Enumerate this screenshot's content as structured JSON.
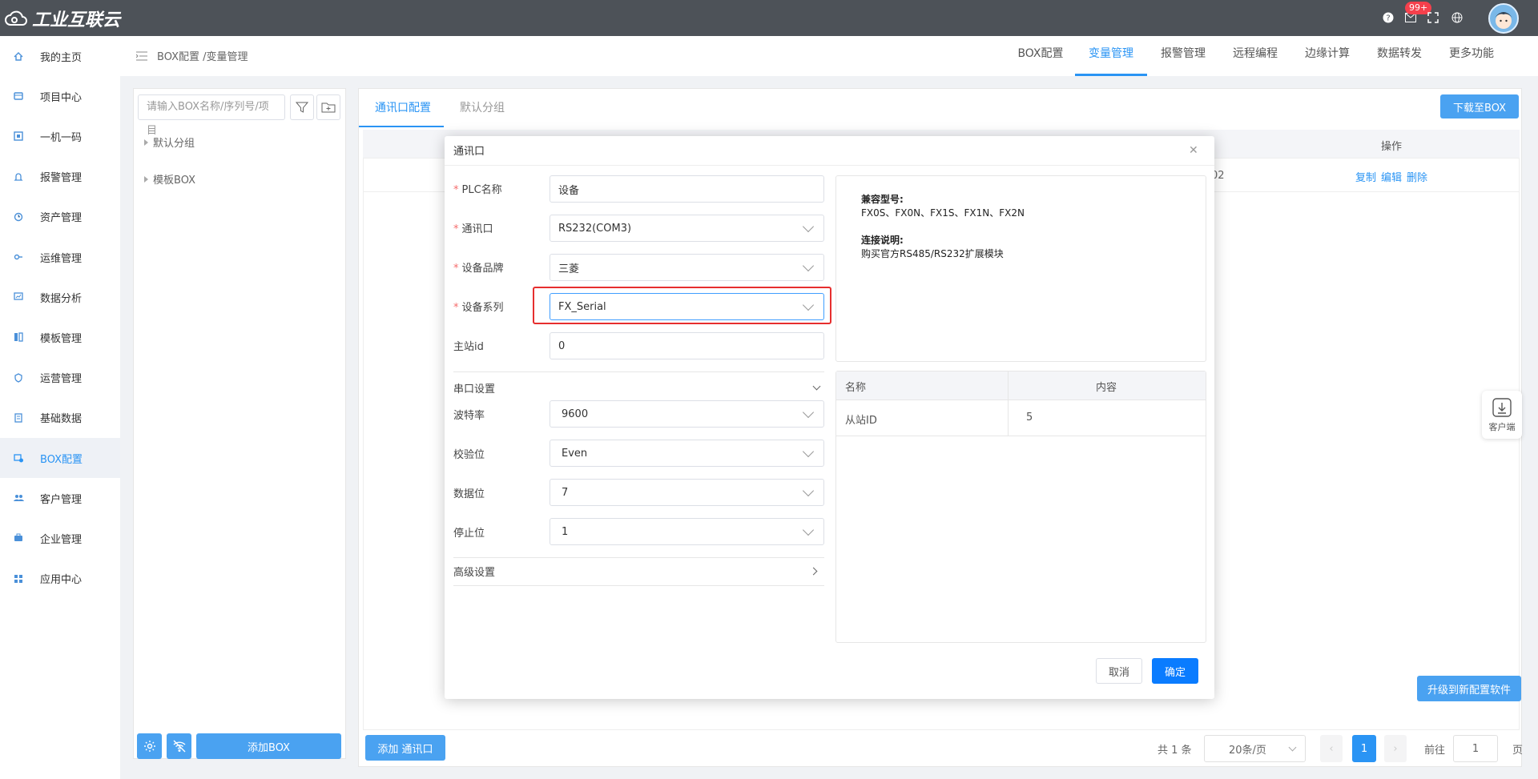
{
  "app": {
    "logo_text": "工业互联云",
    "notification_badge": "99+"
  },
  "sidebar": {
    "items": [
      {
        "label": "我的主页",
        "icon": "home-icon"
      },
      {
        "label": "项目中心",
        "icon": "project-icon"
      },
      {
        "label": "一机一码",
        "icon": "qrcode-icon"
      },
      {
        "label": "报警管理",
        "icon": "bell-icon"
      },
      {
        "label": "资产管理",
        "icon": "asset-icon"
      },
      {
        "label": "运维管理",
        "icon": "wrench-icon"
      },
      {
        "label": "数据分析",
        "icon": "chart-icon"
      },
      {
        "label": "模板管理",
        "icon": "template-icon"
      },
      {
        "label": "运营管理",
        "icon": "shield-icon"
      },
      {
        "label": "基础数据",
        "icon": "database-icon"
      },
      {
        "label": "BOX配置",
        "icon": "box-icon"
      },
      {
        "label": "客户管理",
        "icon": "users-icon"
      },
      {
        "label": "企业管理",
        "icon": "briefcase-icon"
      },
      {
        "label": "应用中心",
        "icon": "grid-icon"
      }
    ],
    "active_index": 10
  },
  "breadcrumb": {
    "text": "BOX配置 /变量管理"
  },
  "topnav": {
    "tabs": [
      "BOX配置",
      "变量管理",
      "报警管理",
      "远程编程",
      "边缘计算",
      "数据转发",
      "更多功能"
    ],
    "active_index": 1
  },
  "tree": {
    "search_placeholder": "请输入BOX名称/序列号/项目",
    "nodes": [
      "默认分组",
      "模板BOX"
    ],
    "add_box_label": "添加BOX"
  },
  "main": {
    "tabs": [
      "通讯口配置",
      "默认分组"
    ],
    "active_tab_index": 0,
    "download_button": "下载至BOX",
    "table_header_action": "操作",
    "row_partial_text": "02",
    "row_actions": [
      "复制",
      "编辑",
      "删除"
    ],
    "add_port_button": "添加 通讯口",
    "upgrade_button": "升级到新配置软件",
    "pagination": {
      "total": "共 1 条",
      "page_size": "20条/页",
      "current_page": "1",
      "goto_label": "前往",
      "goto_value": "1",
      "page_suffix": "页"
    }
  },
  "dialog": {
    "title": "通讯口",
    "fields": {
      "plc_name": {
        "label": "PLC名称",
        "value": "设备",
        "required": true
      },
      "port": {
        "label": "通讯口",
        "value": "RS232(COM3)",
        "required": true
      },
      "brand": {
        "label": "设备品牌",
        "value": "三菱",
        "required": true
      },
      "series": {
        "label": "设备系列",
        "value": "FX_Serial",
        "required": true
      },
      "station_id": {
        "label": "主站id",
        "value": "0",
        "required": false
      }
    },
    "serial_section": "串口设置",
    "serial": {
      "baud": {
        "label": "波特率",
        "value": "9600"
      },
      "parity": {
        "label": "校验位",
        "value": "Even"
      },
      "databits": {
        "label": "数据位",
        "value": "7"
      },
      "stopbits": {
        "label": "停止位",
        "value": "1"
      }
    },
    "advanced_section": "高级设置",
    "info": {
      "compat_title": "兼容型号:",
      "compat_models": "FX0S、FX0N、FX1S、FX1N、FX2N",
      "conn_title": "连接说明:",
      "conn_text": "购买官方RS485/RS232扩展模块"
    },
    "kv_table": {
      "headers": [
        "名称",
        "内容"
      ],
      "rows": [
        {
          "name": "从站ID",
          "value": "5"
        }
      ]
    },
    "cancel_label": "取消",
    "confirm_label": "确定"
  },
  "floating": {
    "client_label": "客户端"
  },
  "colors": {
    "accent": "#2a94f4",
    "topbar": "#4d5258",
    "danger": "#e62e2e"
  }
}
